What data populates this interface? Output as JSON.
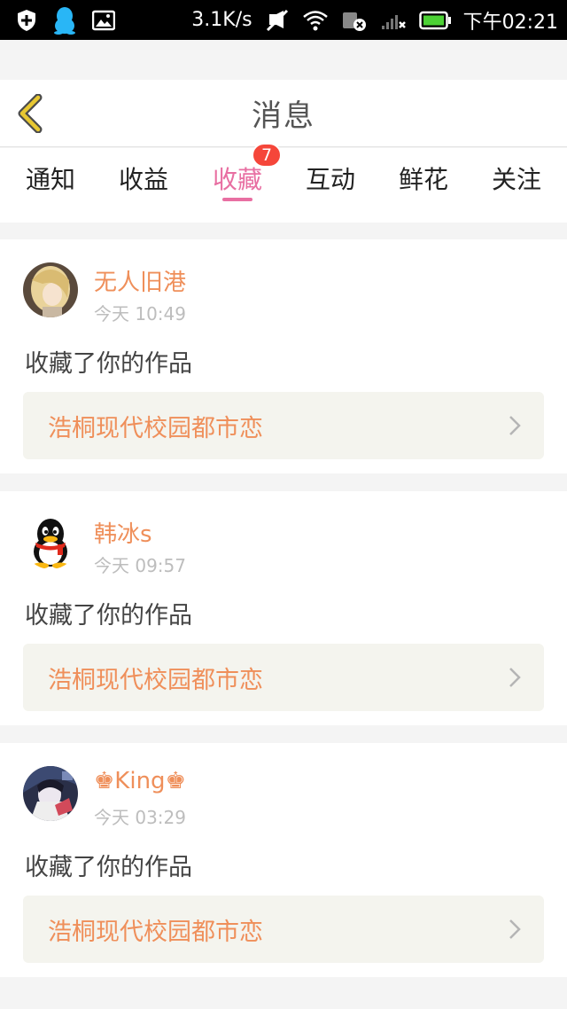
{
  "status_bar": {
    "network_speed": "3.1K/s",
    "time": "下午02:21"
  },
  "header": {
    "title": "消息"
  },
  "tabs": [
    {
      "label": "通知",
      "active": false
    },
    {
      "label": "收益",
      "active": false
    },
    {
      "label": "收藏",
      "active": true,
      "badge": "7"
    },
    {
      "label": "互动",
      "active": false
    },
    {
      "label": "鲜花",
      "active": false
    },
    {
      "label": "关注",
      "active": false
    }
  ],
  "messages": [
    {
      "username": "无人旧港",
      "time": "今天 10:49",
      "action": "收藏了你的作品",
      "work_title": "浩桐现代校园都市恋"
    },
    {
      "username": "韩冰s",
      "time": "今天 09:57",
      "action": "收藏了你的作品",
      "work_title": "浩桐现代校园都市恋"
    },
    {
      "username": "♚King♚",
      "time": "今天 03:29",
      "action": "收藏了你的作品",
      "work_title": "浩桐现代校园都市恋"
    }
  ],
  "colors": {
    "accent": "#e86fa2",
    "username": "#ef8f5a",
    "badge": "#f5463a",
    "back_arrow": "#e8c832"
  }
}
